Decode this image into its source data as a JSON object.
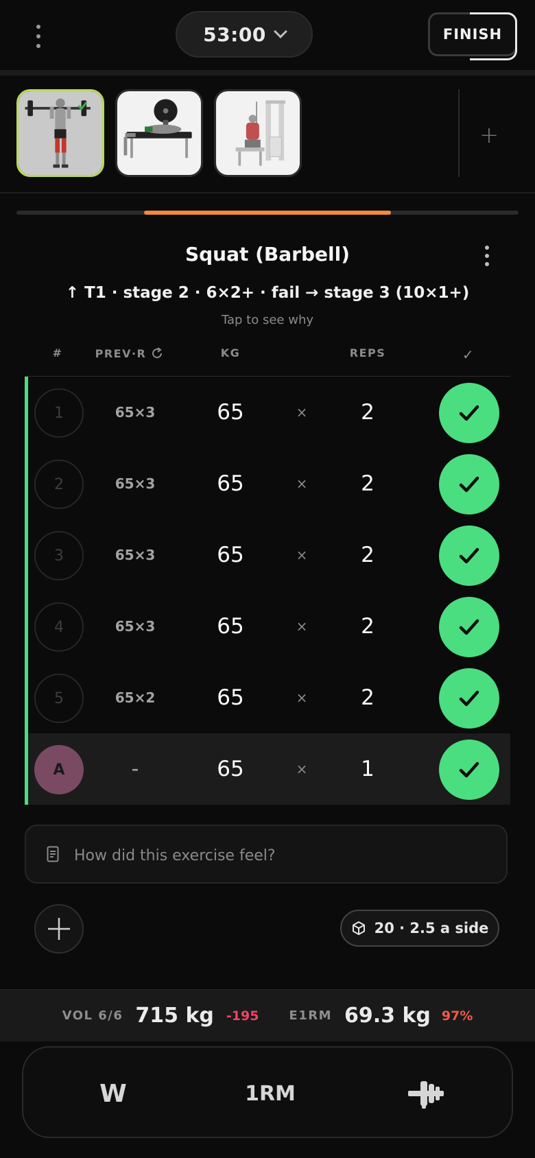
{
  "header": {
    "timer": "53:00",
    "finish_label": "FINISH"
  },
  "exercise_strip": {
    "items": [
      {
        "name": "Squat (Barbell)",
        "active": true,
        "icon": "squat-thumbnail"
      },
      {
        "name": "Bench Press",
        "active": false,
        "icon": "bench-press-thumbnail"
      },
      {
        "name": "Cable Row",
        "active": false,
        "icon": "seated-row-thumbnail"
      }
    ],
    "add_label": "+"
  },
  "exercise": {
    "title": "Squat (Barbell)",
    "stage_info": "↑ T1 · stage 2 · 6×2+ · fail → stage 3 (10×1+)",
    "tap_hint": "Tap to see why"
  },
  "table": {
    "headers": {
      "num": "#",
      "prev": "PREV·R",
      "kg": "KG",
      "reps": "REPS",
      "check": "✓"
    },
    "times_symbol": "×",
    "rows": [
      {
        "set": "1",
        "prev": "65×3",
        "kg": "65",
        "reps": "2",
        "done": true,
        "type": "normal"
      },
      {
        "set": "2",
        "prev": "65×3",
        "kg": "65",
        "reps": "2",
        "done": true,
        "type": "normal"
      },
      {
        "set": "3",
        "prev": "65×3",
        "kg": "65",
        "reps": "2",
        "done": true,
        "type": "normal"
      },
      {
        "set": "4",
        "prev": "65×3",
        "kg": "65",
        "reps": "2",
        "done": true,
        "type": "normal"
      },
      {
        "set": "5",
        "prev": "65×2",
        "kg": "65",
        "reps": "2",
        "done": true,
        "type": "normal"
      },
      {
        "set": "A",
        "prev": "–",
        "kg": "65",
        "reps": "1",
        "done": true,
        "type": "amrap"
      }
    ]
  },
  "notes": {
    "placeholder": "How did this exercise feel?"
  },
  "plates": {
    "label": "20 · 2.5 a side"
  },
  "summary": {
    "vol_label": "VOL 6/6",
    "vol_value": "715 kg",
    "vol_delta": "-195",
    "e1rm_label": "E1RM",
    "e1rm_value": "69.3 kg",
    "e1rm_pct": "97%"
  },
  "toolbar": {
    "warmup_label": "W",
    "orm_label": "1RM",
    "plate_icon": "dumbbell-plate-icon"
  },
  "colors": {
    "accent_green": "#4ade80",
    "progress_orange": "#f28a3a",
    "active_thumb_border": "#b8d95a",
    "negative_red": "#ef4461",
    "amrap_badge": "#7a4a63"
  }
}
